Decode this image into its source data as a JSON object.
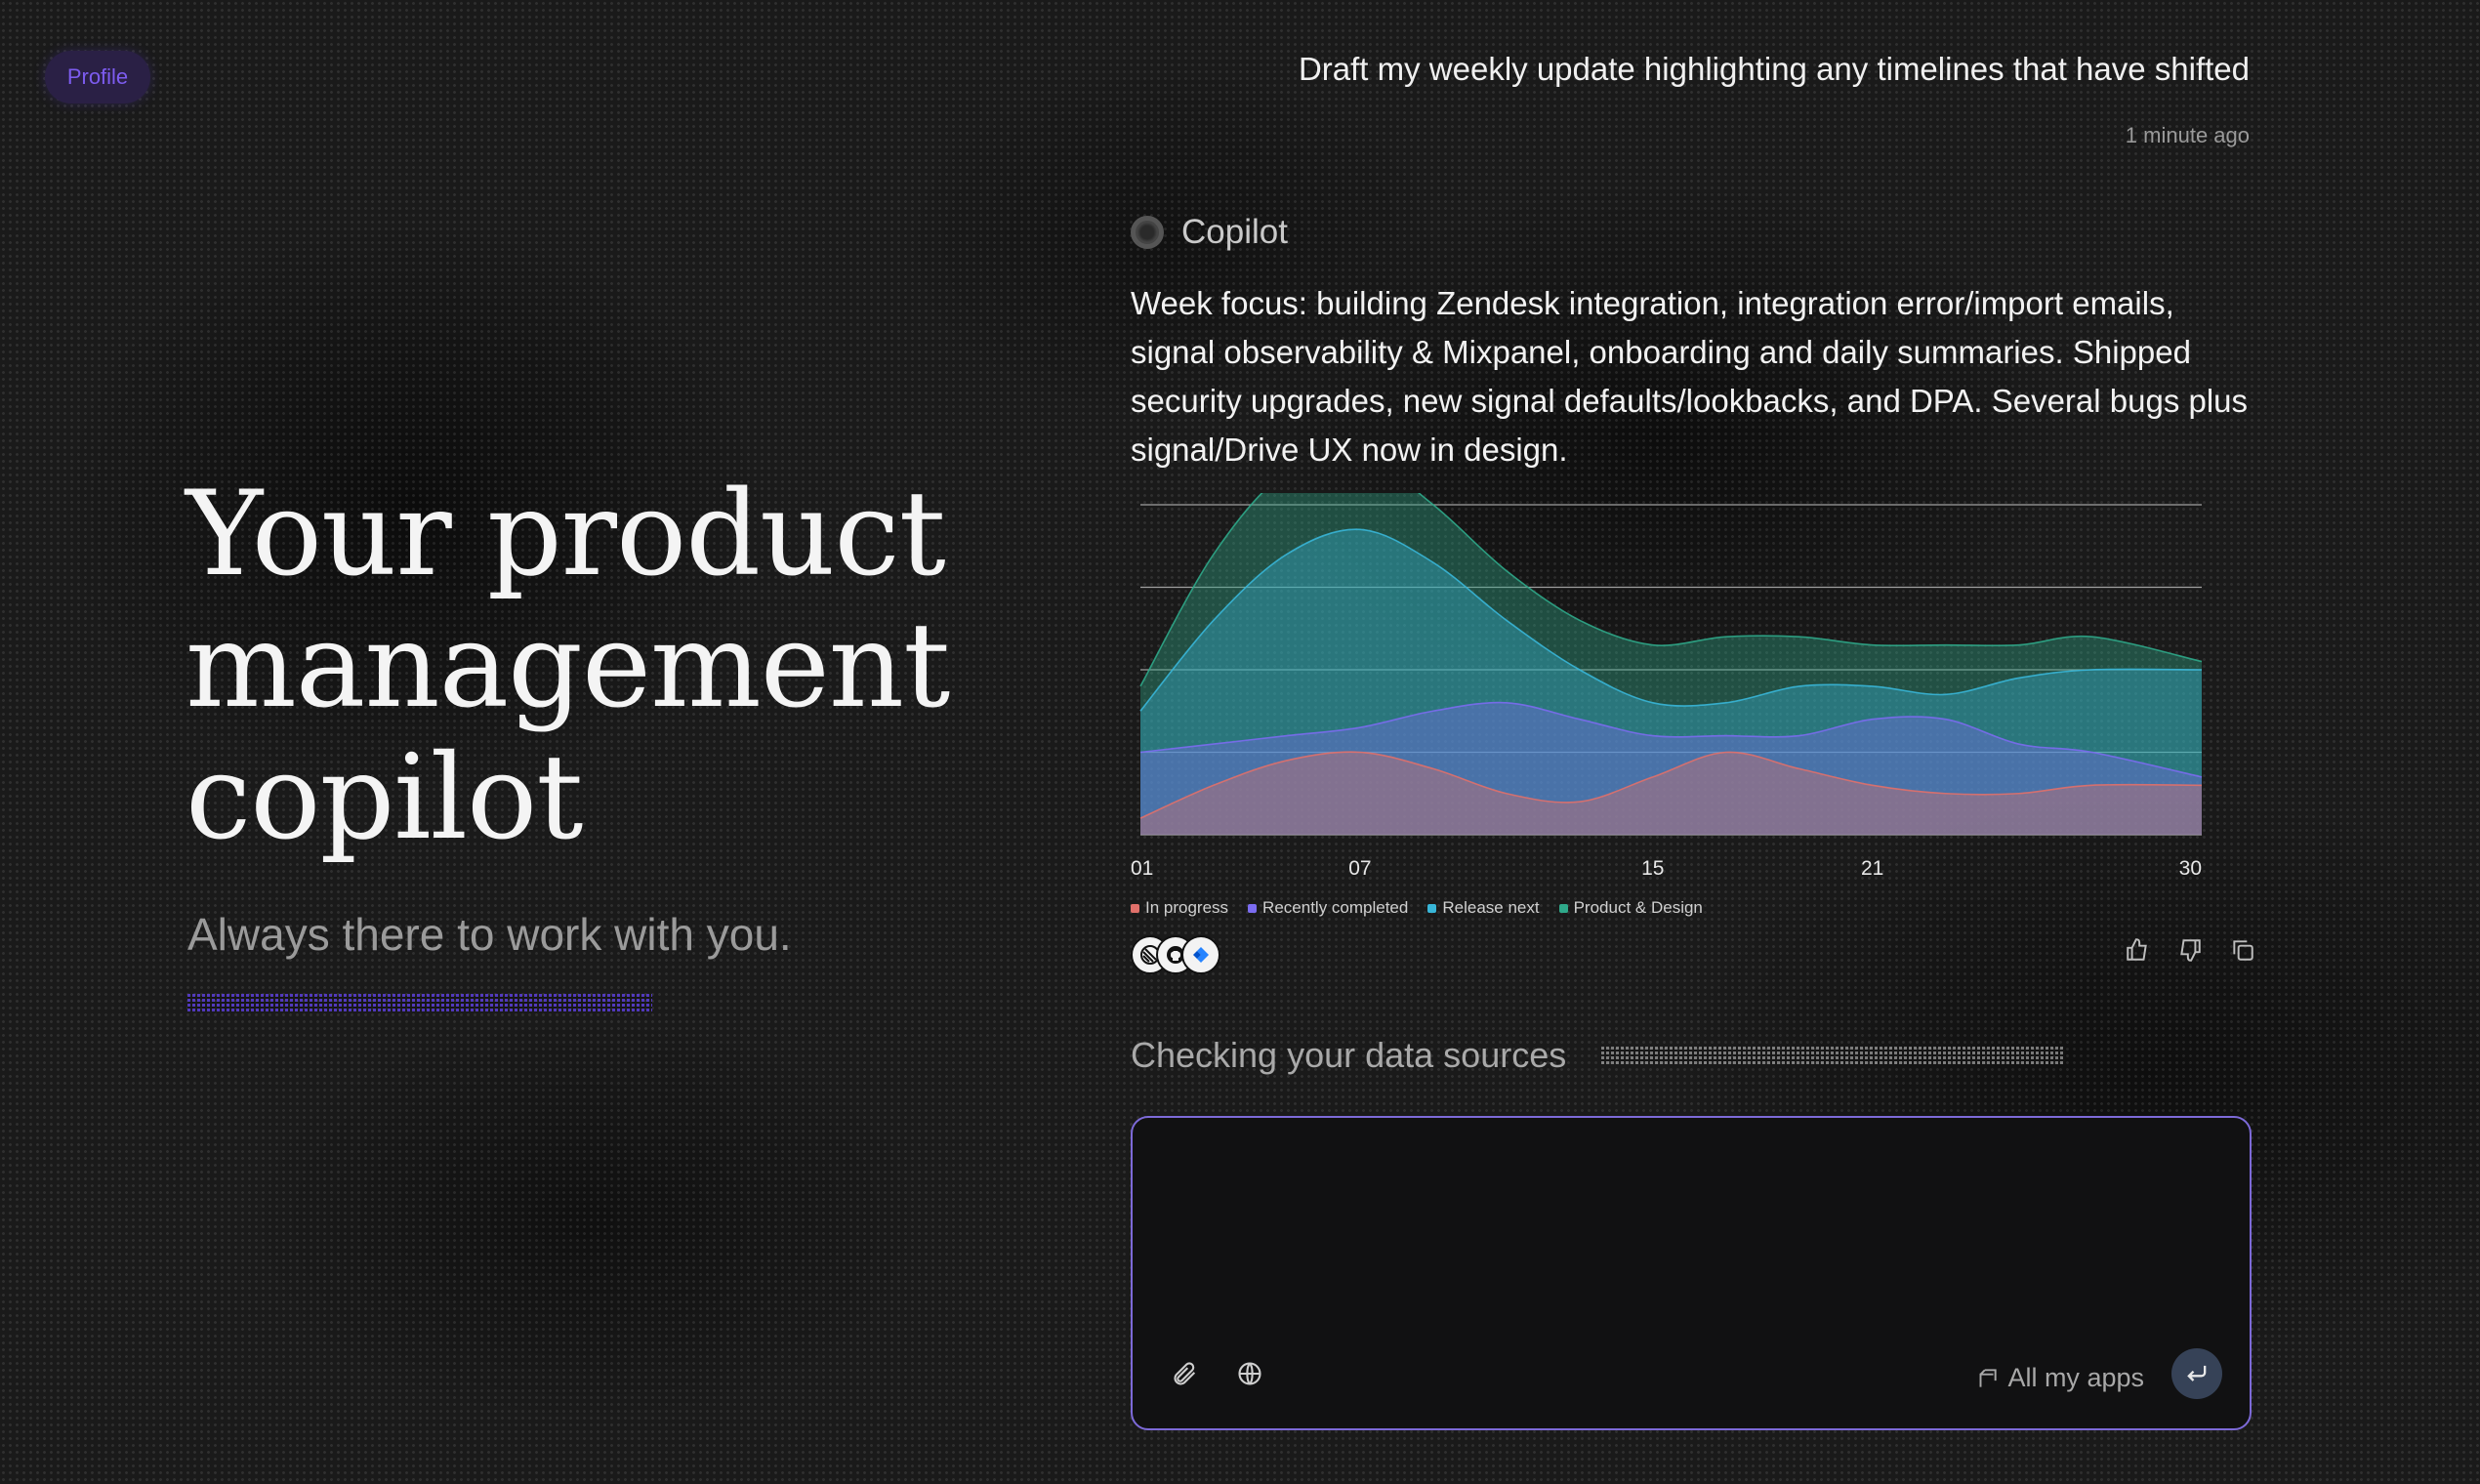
{
  "profile": {
    "label": "Profile"
  },
  "hero": {
    "title": "Your product management copilot",
    "subtitle": "Always there to work with you."
  },
  "conversation": {
    "user_message": "Draft my weekly update highlighting any timelines that have shifted",
    "user_time": "1 minute ago",
    "assistant_name": "Copilot",
    "assistant_text": "Week focus: building Zendesk integration, integration error/import emails, signal observability & Mixpanel, onboarding and daily summaries. Shipped security upgrades, new signal defaults/lookbacks, and DPA. Several bugs plus signal/Drive UX now in design.",
    "source_icons": [
      "linear-icon",
      "github-icon",
      "jira-icon"
    ]
  },
  "chart_data": {
    "type": "area",
    "x": [
      1,
      3,
      5,
      7,
      9,
      11,
      13,
      15,
      17,
      19,
      21,
      23,
      25,
      27,
      30
    ],
    "x_ticks": [
      "01",
      "07",
      "15",
      "21",
      "30"
    ],
    "x_tick_values": [
      1,
      7,
      15,
      21,
      30
    ],
    "grid": true,
    "legend_position": "bottom-left",
    "series": [
      {
        "name": "In progress",
        "color": "#e0706a",
        "values": [
          2,
          6,
          9,
          10,
          8,
          5,
          4,
          7,
          10,
          8,
          6,
          5,
          5,
          6,
          6
        ]
      },
      {
        "name": "Recently completed",
        "color": "#7b6cf0",
        "values": [
          8,
          5,
          3,
          3,
          7,
          11,
          10,
          5,
          2,
          4,
          8,
          9,
          6,
          4,
          1
        ]
      },
      {
        "name": "Release next",
        "color": "#38b6d8",
        "values": [
          5,
          15,
          22,
          24,
          18,
          10,
          6,
          4,
          4,
          6,
          4,
          3,
          8,
          10,
          13
        ]
      },
      {
        "name": "Product & Design",
        "color": "#2fa98a",
        "values": [
          3,
          8,
          10,
          9,
          7,
          6,
          6,
          7,
          8,
          6,
          5,
          6,
          4,
          4,
          1
        ]
      }
    ],
    "ylim": [
      0,
      40
    ]
  },
  "status": {
    "label": "Checking your data sources"
  },
  "composer": {
    "placeholder": "",
    "apps_label": "All my apps"
  },
  "icons": {
    "attach": "paperclip-icon",
    "web": "globe-icon",
    "apps": "apps-icon",
    "send": "enter-icon",
    "like": "thumbs-up-icon",
    "dislike": "thumbs-down-icon",
    "copy": "copy-icon"
  }
}
